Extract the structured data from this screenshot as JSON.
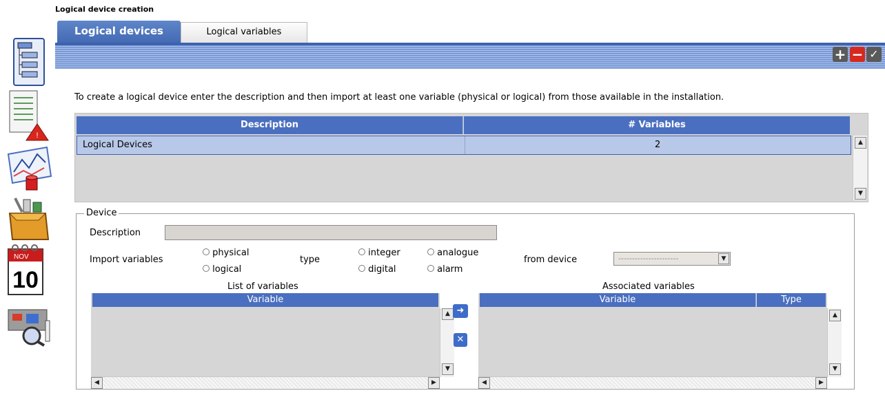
{
  "window": {
    "title": "Logical device creation"
  },
  "tabs": [
    {
      "label": "Logical devices",
      "active": true
    },
    {
      "label": "Logical variables",
      "active": false
    }
  ],
  "toolbar": {
    "add_icon": "plus-icon",
    "remove_icon": "minus-icon",
    "confirm_icon": "check-icon"
  },
  "instructions": "To create a logical device enter the description and then import at least one variable (physical or logical) from those available in the installation.",
  "devices_table": {
    "columns": [
      "Description",
      "# Variables"
    ],
    "rows": [
      {
        "description": "Logical Devices",
        "variables": "2",
        "selected": true
      }
    ]
  },
  "device": {
    "legend": "Device",
    "description_label": "Description",
    "description_value": "",
    "import_label": "Import variables",
    "import_options": [
      "physical",
      "logical"
    ],
    "type_label": "type",
    "type_options": [
      "integer",
      "digital",
      "analogue",
      "alarm"
    ],
    "from_device_label": "from device",
    "from_device_value": "----------------------"
  },
  "list_of_variables": {
    "title": "List of variables",
    "columns": [
      "Variable"
    ]
  },
  "associated_variables": {
    "title": "Associated variables",
    "columns": [
      "Variable",
      "Type"
    ]
  },
  "colors": {
    "accent": "#4a6fc0",
    "tab_active": "#4f77bf",
    "grid_bg": "#d6d6d6"
  }
}
